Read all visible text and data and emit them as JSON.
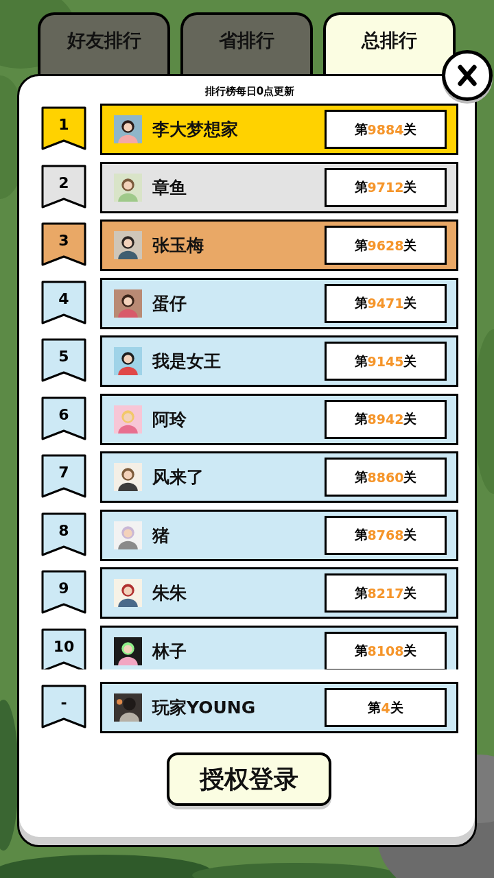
{
  "tabs": [
    {
      "label": "好友排行",
      "selected": false
    },
    {
      "label": "省排行",
      "selected": false
    },
    {
      "label": "总排行",
      "selected": true
    }
  ],
  "notice": "排行榜每日0点更新",
  "ranking": [
    {
      "rank": "1",
      "name": "李大梦想家",
      "color": "#ffd200",
      "stage": {
        "prefix": "第",
        "number": "9884",
        "suffix": "关"
      }
    },
    {
      "rank": "2",
      "name": "章鱼",
      "color": "#e3e3e3",
      "stage": {
        "prefix": "第",
        "number": "9712",
        "suffix": "关"
      }
    },
    {
      "rank": "3",
      "name": "张玉梅",
      "color": "#e9a866",
      "stage": {
        "prefix": "第",
        "number": "9628",
        "suffix": "关"
      }
    },
    {
      "rank": "4",
      "name": "蛋仔",
      "color": "#cde9f5",
      "stage": {
        "prefix": "第",
        "number": "9471",
        "suffix": "关"
      }
    },
    {
      "rank": "5",
      "name": "我是女王",
      "color": "#cde9f5",
      "stage": {
        "prefix": "第",
        "number": "9145",
        "suffix": "关"
      }
    },
    {
      "rank": "6",
      "name": "阿玲",
      "color": "#cde9f5",
      "stage": {
        "prefix": "第",
        "number": "8942",
        "suffix": "关"
      }
    },
    {
      "rank": "7",
      "name": "风来了",
      "color": "#cde9f5",
      "stage": {
        "prefix": "第",
        "number": "8860",
        "suffix": "关"
      }
    },
    {
      "rank": "8",
      "name": "猪",
      "color": "#cde9f5",
      "stage": {
        "prefix": "第",
        "number": "8768",
        "suffix": "关"
      }
    },
    {
      "rank": "9",
      "name": "朱朱",
      "color": "#cde9f5",
      "stage": {
        "prefix": "第",
        "number": "8217",
        "suffix": "关"
      }
    },
    {
      "rank": "10",
      "name": "林子",
      "color": "#cde9f5",
      "stage": {
        "prefix": "第",
        "number": "8108",
        "suffix": "关"
      }
    }
  ],
  "me": {
    "rank": "-",
    "name": "玩家YOUNG",
    "color": "#cde9f5",
    "stage": {
      "prefix": "第",
      "number": "4",
      "suffix": "关"
    }
  },
  "login_button": "授权登录"
}
